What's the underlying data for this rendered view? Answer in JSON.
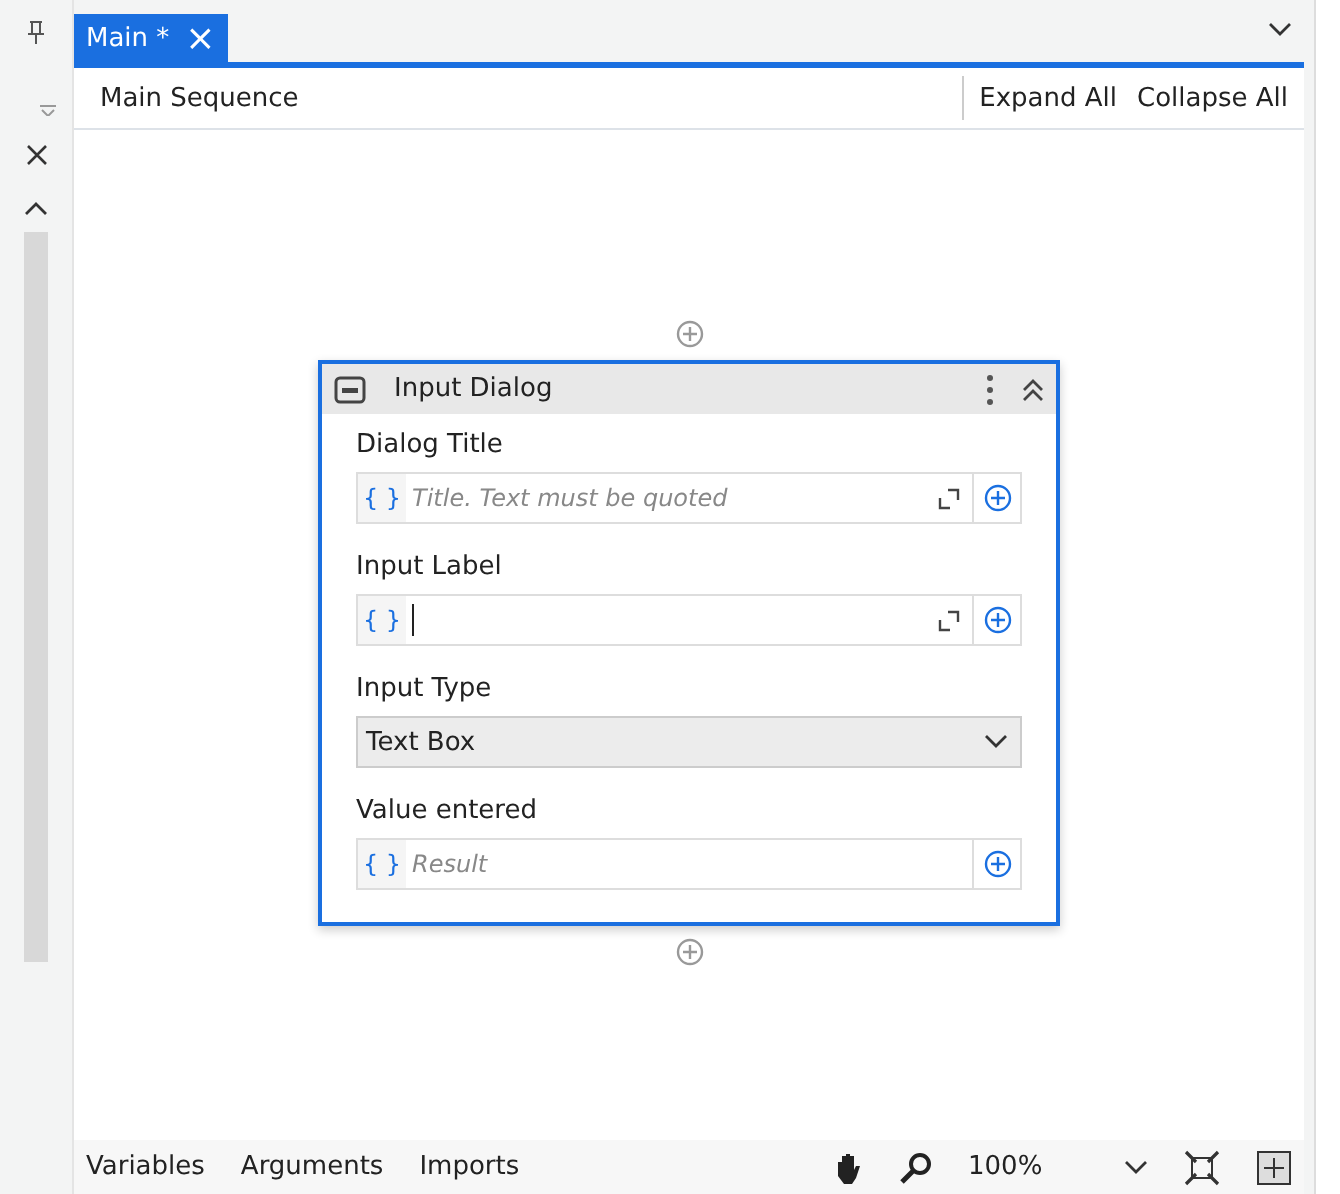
{
  "tabs": [
    {
      "label": "Main *",
      "selected": true,
      "close": "×"
    }
  ],
  "header": {
    "breadcrumb": "Main Sequence",
    "actions": [
      "Expand All",
      "Collapse All"
    ]
  },
  "activity": {
    "title": "Input Dialog",
    "selected": true,
    "fields": [
      {
        "label": "Dialog Title",
        "kind": "expression",
        "brace": "{ }",
        "placeholder": "Title. Text must be quoted",
        "expandable": true,
        "focused": false
      },
      {
        "label": "Input Label",
        "kind": "expression",
        "brace": "{ }",
        "expandable": true,
        "focused": true
      },
      {
        "label": "Input Type",
        "kind": "dropdown",
        "value": "Text Box"
      },
      {
        "label": "Value entered",
        "kind": "expression",
        "brace": "{ }",
        "placeholder": "Result",
        "expandable": false,
        "focused": false
      }
    ]
  },
  "bottom_bar": {
    "tabs": [
      "Variables",
      "Arguments",
      "Imports"
    ],
    "zoom": "100%"
  }
}
